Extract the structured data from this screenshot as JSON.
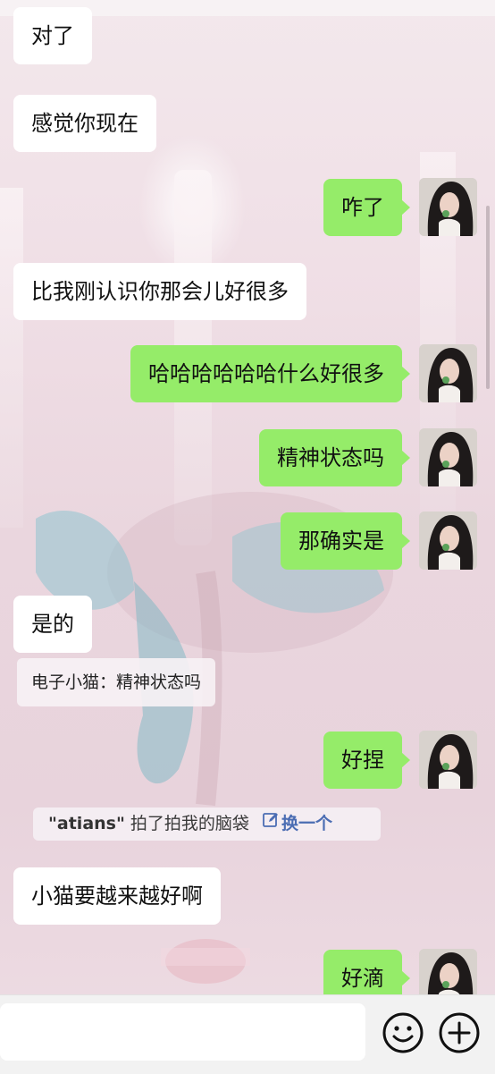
{
  "messages": [
    {
      "side": "in",
      "text": "对了"
    },
    {
      "side": "in",
      "text": "感觉你现在"
    },
    {
      "side": "out",
      "text": "咋了"
    },
    {
      "side": "in",
      "text": "比我刚认识你那会儿好很多"
    },
    {
      "side": "out",
      "text": "哈哈哈哈哈哈什么好很多"
    },
    {
      "side": "out",
      "text": "精神状态吗"
    },
    {
      "side": "out",
      "text": "那确实是"
    },
    {
      "side": "in",
      "text": "是的"
    },
    {
      "side": "out",
      "text": "好捏"
    },
    {
      "side": "in",
      "text": "小猫要越来越好啊"
    },
    {
      "side": "out",
      "text": "好滴"
    }
  ],
  "quote": {
    "text": "电子小猫：精神状态吗"
  },
  "pat_notice": {
    "name": "\"atians\"",
    "text": " 拍了拍我的脑袋",
    "action": "换一个"
  },
  "input": {
    "placeholder": ""
  },
  "icons": {
    "emoji": "emoji-icon",
    "plus": "plus-icon",
    "edit": "edit-icon"
  },
  "colors": {
    "outgoing_bubble": "#95ec69",
    "incoming_bubble": "#ffffff",
    "link": "#4b6db3"
  }
}
